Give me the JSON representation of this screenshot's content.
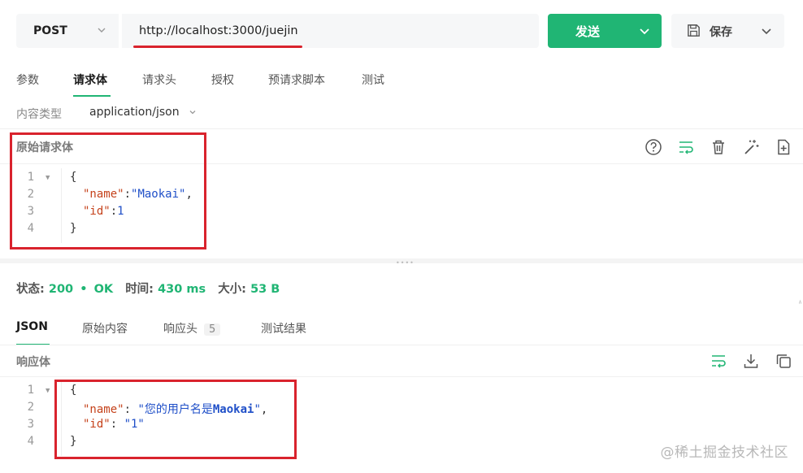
{
  "request": {
    "method": "POST",
    "url": "http://localhost:3000/juejin",
    "send_label": "发送",
    "save_label": "保存"
  },
  "request_tabs": [
    {
      "label": "参数",
      "active": false
    },
    {
      "label": "请求体",
      "active": true
    },
    {
      "label": "请求头",
      "active": false
    },
    {
      "label": "授权",
      "active": false
    },
    {
      "label": "预请求脚本",
      "active": false
    },
    {
      "label": "测试",
      "active": false
    }
  ],
  "content_type": {
    "label": "内容类型",
    "value": "application/json"
  },
  "raw_body": {
    "title": "原始请求体",
    "line_numbers": [
      "1",
      "2",
      "3",
      "4"
    ],
    "line1": "{",
    "line2_key": "\"name\"",
    "line2_sep": ":",
    "line2_val": "\"Maokai\"",
    "line2_end": ",",
    "line3_key": "\"id\"",
    "line3_sep": ":",
    "line3_val": "1",
    "line4": "}"
  },
  "response_status": {
    "status_label": "状态:",
    "status_code": "200",
    "dot": "•",
    "status_text": "OK",
    "time_label": "时间:",
    "time_value": "430 ms",
    "size_label": "大小:",
    "size_value": "53 B"
  },
  "response_tabs": [
    {
      "label": "JSON",
      "active": true
    },
    {
      "label": "原始内容",
      "active": false
    },
    {
      "label": "响应头",
      "active": false,
      "badge": "5"
    },
    {
      "label": "测试结果",
      "active": false
    }
  ],
  "response_body": {
    "title": "响应体",
    "line_numbers": [
      "1",
      "2",
      "3",
      "4"
    ],
    "line1": "{",
    "line2_key": "\"name\"",
    "line2_sep": ": ",
    "line2_val_open": "\"您的用户名是",
    "line2_val_mid": "Maokai",
    "line2_val_close": "\"",
    "line2_end": ",",
    "line3_key": "\"id\"",
    "line3_sep": ": ",
    "line3_val": "\"1\"",
    "line4": "}"
  },
  "watermark": "@稀土掘金技术社区",
  "colors": {
    "accent": "#20b574",
    "highlight": "#d9232d"
  }
}
